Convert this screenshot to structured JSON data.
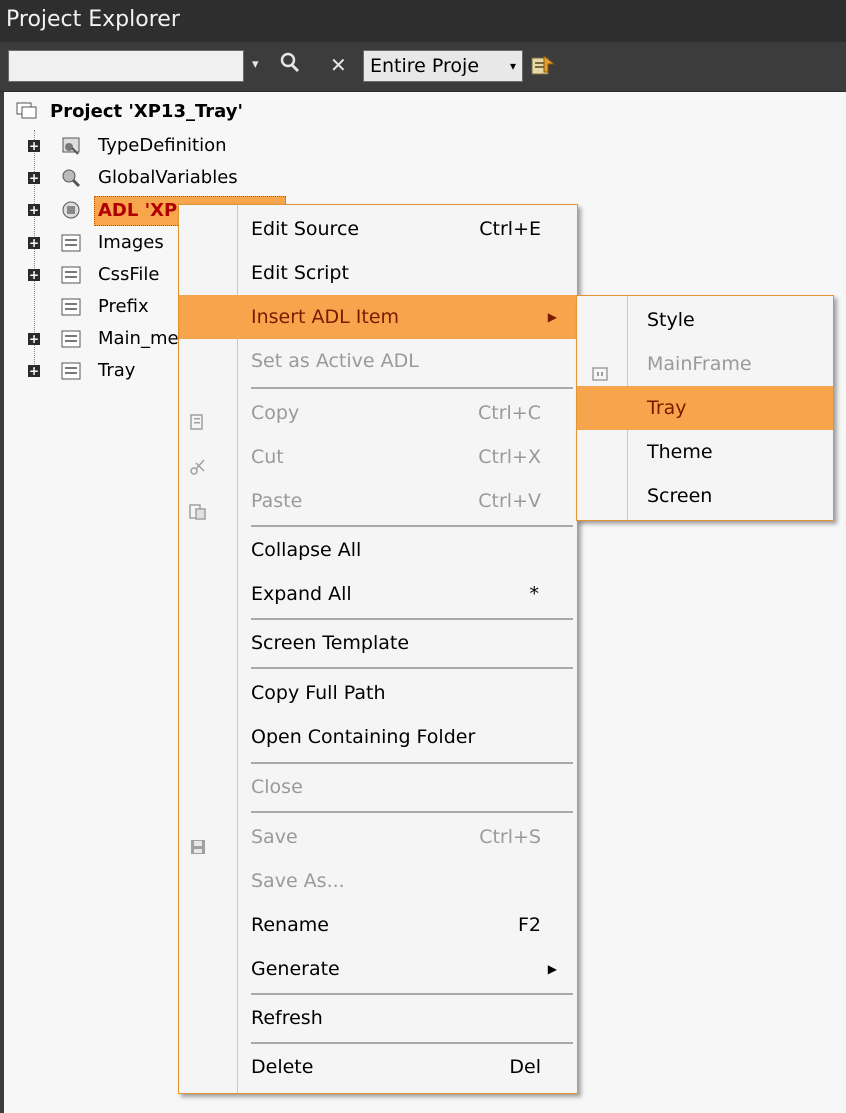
{
  "window": {
    "title": "Project Explorer"
  },
  "toolbar": {
    "search_value": "",
    "scope_value": "Entire Proje",
    "dropdown_arrow": "▾",
    "search_glyph": "⚲",
    "clear_glyph": "✕"
  },
  "tree": {
    "root_label": "Project 'XP13_Tray'",
    "items": [
      {
        "label": "TypeDefinition"
      },
      {
        "label": "GlobalVariables"
      },
      {
        "label": "ADL 'XP"
      },
      {
        "label": "Images"
      },
      {
        "label": "CssFile"
      },
      {
        "label": "Prefix"
      },
      {
        "label": "Main_me"
      },
      {
        "label": "Tray"
      }
    ],
    "expander_glyph": "+"
  },
  "context_menu": {
    "items": [
      {
        "label": "Edit Source",
        "shortcut": "Ctrl+E"
      },
      {
        "label": "Edit Script",
        "shortcut": ""
      },
      {
        "label": "Insert ADL Item",
        "shortcut": "",
        "submenu_arrow": "▶"
      },
      {
        "label": "Set as Active ADL",
        "shortcut": ""
      },
      {
        "label": "Copy",
        "shortcut": "Ctrl+C"
      },
      {
        "label": "Cut",
        "shortcut": "Ctrl+X"
      },
      {
        "label": "Paste",
        "shortcut": "Ctrl+V"
      },
      {
        "label": "Collapse All",
        "shortcut": ""
      },
      {
        "label": "Expand All",
        "shortcut": "*"
      },
      {
        "label": "Screen Template",
        "shortcut": ""
      },
      {
        "label": "Copy Full Path",
        "shortcut": ""
      },
      {
        "label": "Open Containing Folder",
        "shortcut": ""
      },
      {
        "label": "Close",
        "shortcut": ""
      },
      {
        "label": "Save",
        "shortcut": "Ctrl+S"
      },
      {
        "label": "Save As...",
        "shortcut": ""
      },
      {
        "label": "Rename",
        "shortcut": "F2"
      },
      {
        "label": "Generate",
        "shortcut": "",
        "submenu_arrow": "▶"
      },
      {
        "label": "Refresh",
        "shortcut": ""
      },
      {
        "label": "Delete",
        "shortcut": "Del"
      }
    ]
  },
  "submenu": {
    "items": [
      {
        "label": "Style"
      },
      {
        "label": "MainFrame"
      },
      {
        "label": "Tray"
      },
      {
        "label": "Theme"
      },
      {
        "label": "Screen"
      }
    ]
  },
  "colors": {
    "highlight": "#f6a54c",
    "selected_node": "#f7a64d",
    "menu_border": "#e0952f",
    "titlebar": "#2e2e2e"
  }
}
